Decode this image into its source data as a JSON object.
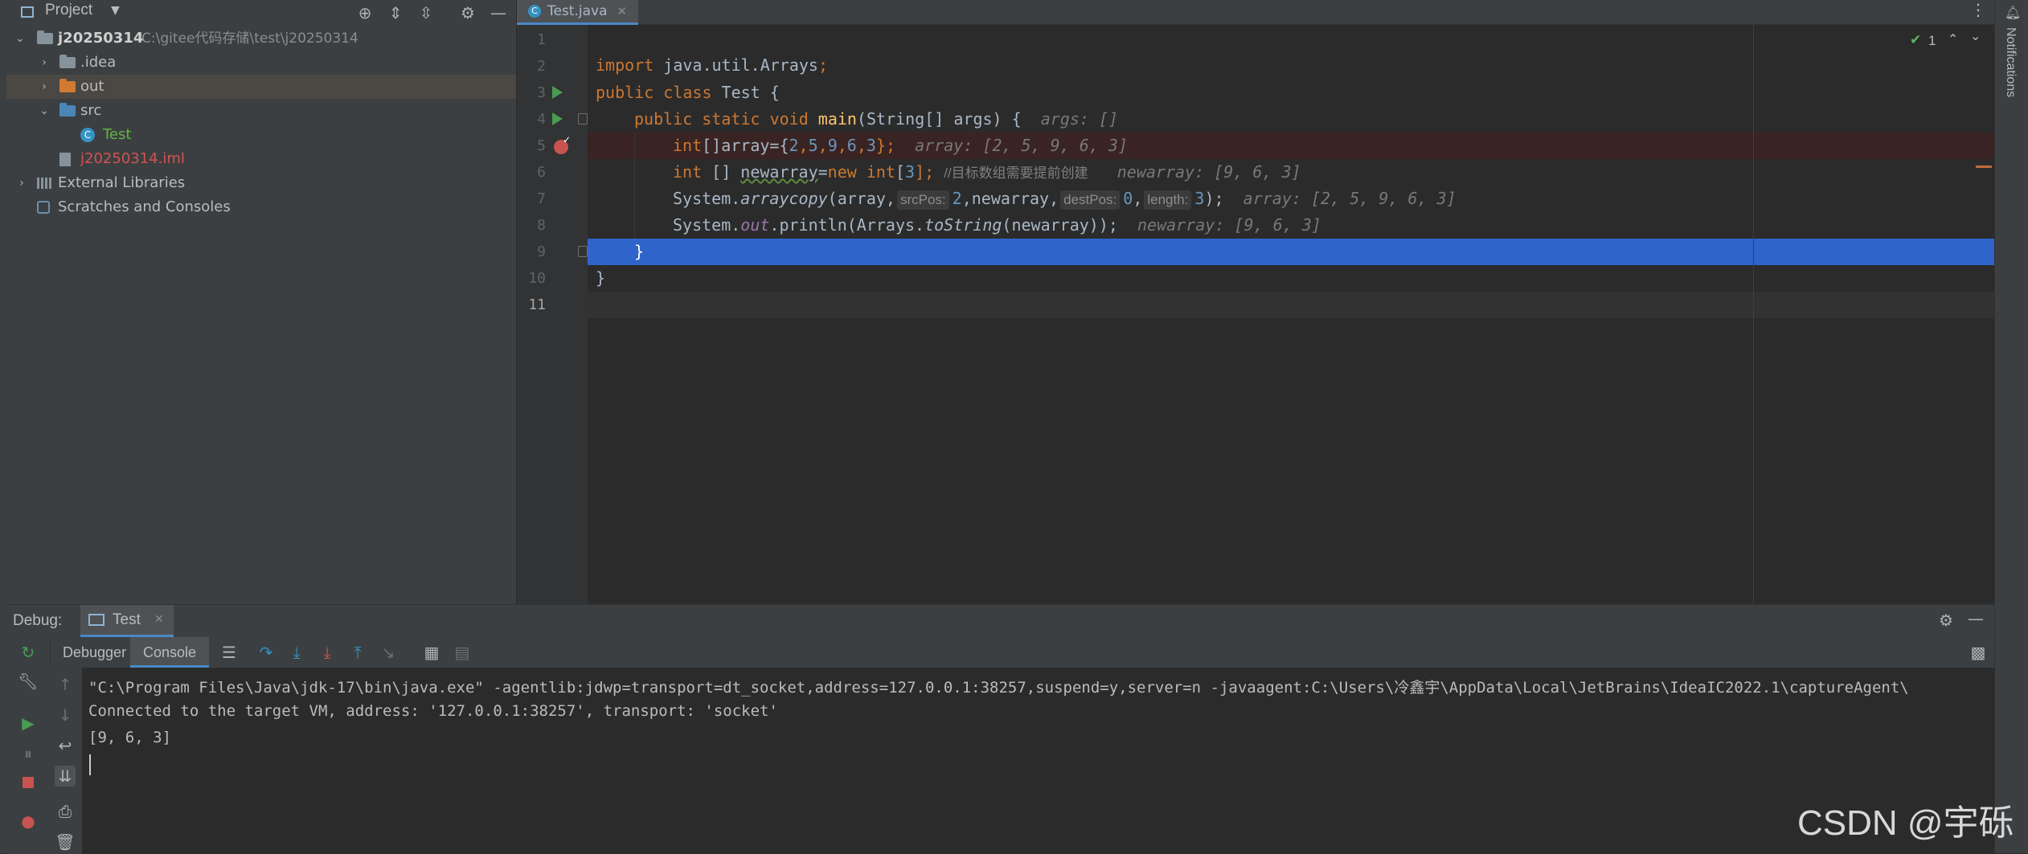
{
  "project_panel": {
    "title": "Project",
    "tree": [
      {
        "label": "j20250314",
        "path": "C:\\gitee代码存储\\test\\j20250314"
      },
      {
        "label": ".idea"
      },
      {
        "label": "out"
      },
      {
        "label": "src"
      },
      {
        "label": "Test"
      },
      {
        "label": "j20250314.iml"
      },
      {
        "label": "External Libraries"
      },
      {
        "label": "Scratches and Consoles"
      }
    ]
  },
  "editor": {
    "tab_label": "Test.java",
    "inspection_count": "1",
    "line_numbers": [
      "1",
      "2",
      "3",
      "4",
      "5",
      "6",
      "7",
      "8",
      "9",
      "10",
      "11"
    ],
    "lines": {
      "l1": {
        "kw": "import",
        "text": " java.util.Arrays",
        "semi": ";"
      },
      "l3": {
        "kw": "public class",
        "text": " Test {"
      },
      "l4": {
        "kw": "public static void",
        "fn": "main",
        "text": "(String[] args) {",
        "hint": "args: []"
      },
      "l5": {
        "kw": "int",
        "text_a": "[]array={",
        "nums": [
          "2",
          "5",
          "9",
          "6",
          "3"
        ],
        "text_b": "};",
        "hint": "array: [2, 5, 9, 6, 3]"
      },
      "l6": {
        "kw": "int",
        "text_a": " [] ",
        "var": "newarray",
        "text_b": "=",
        "kw2": "new int",
        "text_c": "[",
        "num": "3",
        "text_d": "]; ",
        "comment": "//目标数组需要提前创建",
        "hint": "newarray: [9, 6, 3]"
      },
      "l7": {
        "text_a": "System.",
        "method": "arraycopy",
        "text_b": "(array,",
        "p1": "srcPos:",
        "v1": "2",
        "text_c": ",newarray,",
        "p2": "destPos:",
        "v2": "0",
        "text_d": ",",
        "p3": "length:",
        "v3": "3",
        "text_e": ");",
        "hint": "array: [2, 5, 9, 6, 3]"
      },
      "l8": {
        "text_a": "System.",
        "field": "out",
        "text_b": ".println(Arrays.",
        "method": "toString",
        "text_c": "(newarray));",
        "hint": "newarray: [9, 6, 3]"
      },
      "l9": {
        "text": "}"
      },
      "l10": {
        "text": "}"
      }
    }
  },
  "right_strip": {
    "notifications_label": "Notifications"
  },
  "debug": {
    "label": "Debug:",
    "run_tab": "Test",
    "tabs": [
      "Debugger",
      "Console"
    ],
    "console": [
      "\"C:\\Program Files\\Java\\jdk-17\\bin\\java.exe\" -agentlib:jdwp=transport=dt_socket,address=127.0.0.1:38257,suspend=y,server=n -javaagent:C:\\Users\\冷鑫宇\\AppData\\Local\\JetBrains\\IdeaIC2022.1\\captureAgent\\",
      "Connected to the target VM, address: '127.0.0.1:38257', transport: 'socket'",
      "[9, 6, 3]"
    ]
  },
  "watermark": "CSDN @宇砾",
  "colors": {
    "accent": "#4a88c7",
    "selection_line": "#2f65ca",
    "breakpoint_line": "#3a2323",
    "breakpoint": "#c75450",
    "run_arrow": "#499c54",
    "keyword": "#cc7832",
    "number": "#6897bb"
  }
}
